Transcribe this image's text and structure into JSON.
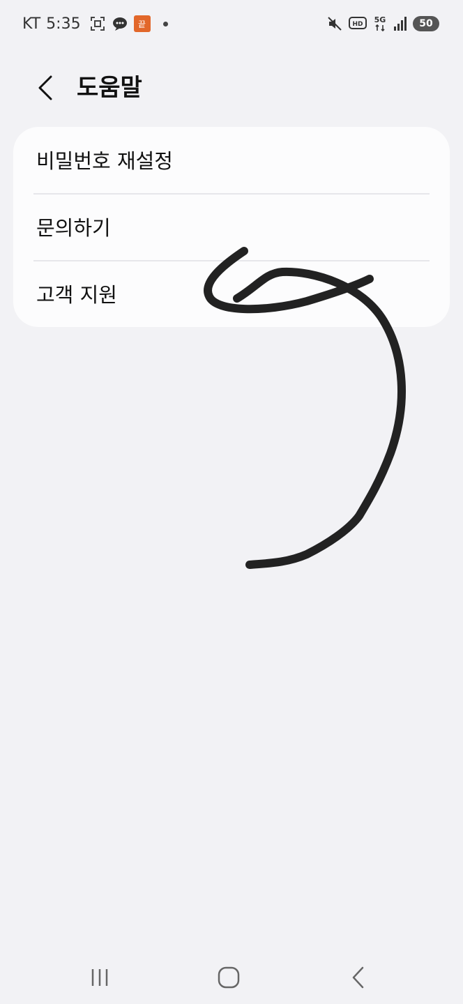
{
  "status_bar": {
    "carrier": "KT",
    "time": "5:35",
    "notification_badge": "끝",
    "battery_level": "50",
    "network": "5G",
    "hd_label": "HD"
  },
  "header": {
    "title": "도움말"
  },
  "menu": {
    "items": [
      {
        "label": "비밀번호 재설정"
      },
      {
        "label": "문의하기"
      },
      {
        "label": "고객 지원"
      }
    ]
  },
  "colors": {
    "background": "#f2f2f5",
    "card": "#fcfcfd",
    "text": "#111111",
    "divider": "#e6e6ea",
    "scribble": "#222222"
  }
}
